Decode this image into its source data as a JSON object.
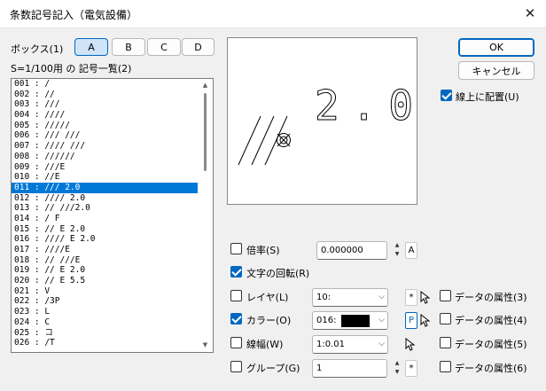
{
  "window": {
    "title": "条数記号記入（電気設備）",
    "close_glyph": "✕"
  },
  "box": {
    "label": "ボックス(1)",
    "tabs": [
      "A",
      "B",
      "C",
      "D"
    ],
    "selected": "A"
  },
  "list": {
    "header": "S=1/100用 の 記号一覧(2)",
    "selected_index": 10,
    "items": [
      "001 : /",
      "002 : //",
      "003 : ///",
      "004 : ////",
      "005 : /////",
      "006 : /// ///",
      "007 : //// ///",
      "008 : //////",
      "009 : ///E",
      "010 : //E",
      "011 : /// 2.0",
      "012 : //// 2.0",
      "013 : // ///2.0",
      "014 : / F",
      "015 : // E 2.0",
      "016 : //// E 2.0",
      "017 : ////E",
      "018 : // ///E",
      "019 : // E 2.0",
      "020 : // E 5.5",
      "021 : V",
      "022 : /3P",
      "023 : L",
      "024 : C",
      "025 : コ",
      "026 : /T"
    ]
  },
  "preview": {
    "text": "2.0"
  },
  "buttons": {
    "ok": "OK",
    "cancel": "キャンセル"
  },
  "on_line": {
    "label": "線上に配置(U)",
    "checked": true
  },
  "scale": {
    "label": "倍率(S)",
    "checked": false,
    "value": "0.000000",
    "suffix": "A"
  },
  "rotate": {
    "label": "文字の回転(R)",
    "checked": true
  },
  "layer": {
    "label": "レイヤ(L)",
    "checked": false,
    "value": "10:",
    "star": "*"
  },
  "color": {
    "label": "カラー(O)",
    "checked": true,
    "value": "016:",
    "swatch": "#000000",
    "p": "P"
  },
  "line_width": {
    "label": "線幅(W)",
    "checked": false,
    "value": "1:0.01"
  },
  "group": {
    "label": "グループ(G)",
    "checked": false,
    "value": "1",
    "star": "*"
  },
  "data_attrs": [
    {
      "label": "データの属性(3)",
      "checked": false
    },
    {
      "label": "データの属性(4)",
      "checked": false
    },
    {
      "label": "データの属性(5)",
      "checked": false
    },
    {
      "label": "データの属性(6)",
      "checked": false
    }
  ]
}
